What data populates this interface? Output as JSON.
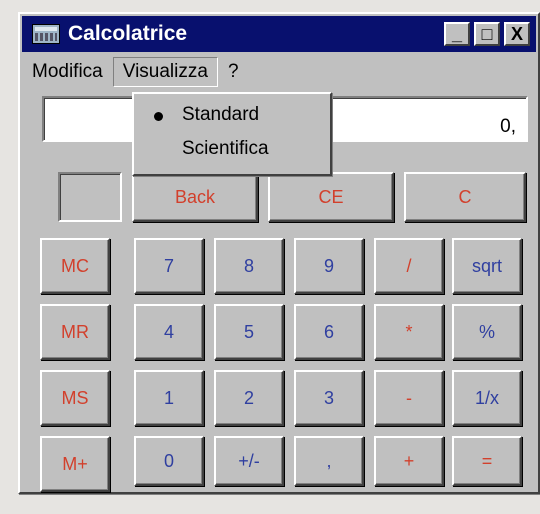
{
  "window": {
    "title": "Calcolatrice",
    "controls": {
      "minimize": "_",
      "maximize": "□",
      "close": "X"
    }
  },
  "menu": {
    "items": [
      "Modifica",
      "Visualizza",
      "?"
    ],
    "open": "Visualizza",
    "dropdown": [
      {
        "label": "Standard",
        "selected": true
      },
      {
        "label": "Scientifica",
        "selected": false
      }
    ]
  },
  "display": {
    "value": "0,"
  },
  "controls_row": [
    "Back",
    "CE",
    "C"
  ],
  "memory": [
    "MC",
    "MR",
    "MS",
    "M+"
  ],
  "keypad": [
    [
      "7",
      "8",
      "9",
      "/",
      "sqrt"
    ],
    [
      "4",
      "5",
      "6",
      "*",
      "%"
    ],
    [
      "1",
      "2",
      "3",
      "-",
      "1/x"
    ],
    [
      "0",
      "+/-",
      ",",
      "+",
      "="
    ]
  ],
  "colors": {
    "titlebar": "#08106e",
    "digits": "#2f3fa0",
    "operators": "#d2402c",
    "face": "#c0c0c0"
  }
}
